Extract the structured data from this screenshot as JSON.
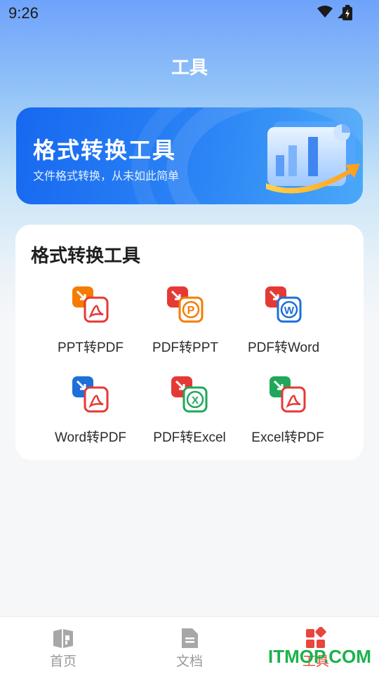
{
  "status": {
    "time": "9:26"
  },
  "header": {
    "title": "工具"
  },
  "banner": {
    "title": "格式转换工具",
    "subtitle": "文件格式转换，从未如此简单"
  },
  "tools_card": {
    "title": "格式转换工具",
    "items": [
      {
        "label": "PPT转PDF",
        "icon": "ppt-to-pdf-icon",
        "src_color": "#f57c00",
        "dst_letter": "",
        "dst_color": "#e53935"
      },
      {
        "label": "PDF转PPT",
        "icon": "pdf-to-ppt-icon",
        "src_color": "#e53935",
        "dst_letter": "P",
        "dst_color": "#f57c00"
      },
      {
        "label": "PDF转Word",
        "icon": "pdf-to-word-icon",
        "src_color": "#e53935",
        "dst_letter": "W",
        "dst_color": "#1e6fd9"
      },
      {
        "label": "Word转PDF",
        "icon": "word-to-pdf-icon",
        "src_color": "#1e6fd9",
        "dst_letter": "",
        "dst_color": "#e53935"
      },
      {
        "label": "PDF转Excel",
        "icon": "pdf-to-excel-icon",
        "src_color": "#e53935",
        "dst_letter": "X",
        "dst_color": "#1fa85a"
      },
      {
        "label": "Excel转PDF",
        "icon": "excel-to-pdf-icon",
        "src_color": "#1fa85a",
        "dst_letter": "",
        "dst_color": "#e53935"
      }
    ]
  },
  "tabbar": {
    "tabs": [
      {
        "label": "首页",
        "icon": "home-doc-icon",
        "active": false
      },
      {
        "label": "文档",
        "icon": "document-icon",
        "active": false
      },
      {
        "label": "工具",
        "icon": "grid-tools-icon",
        "active": true
      }
    ]
  },
  "watermark": {
    "text": "ITMOP.COM"
  },
  "colors": {
    "accent": "#e8453c",
    "banner": "#1768f0",
    "inactive": "#9a9a9a"
  }
}
